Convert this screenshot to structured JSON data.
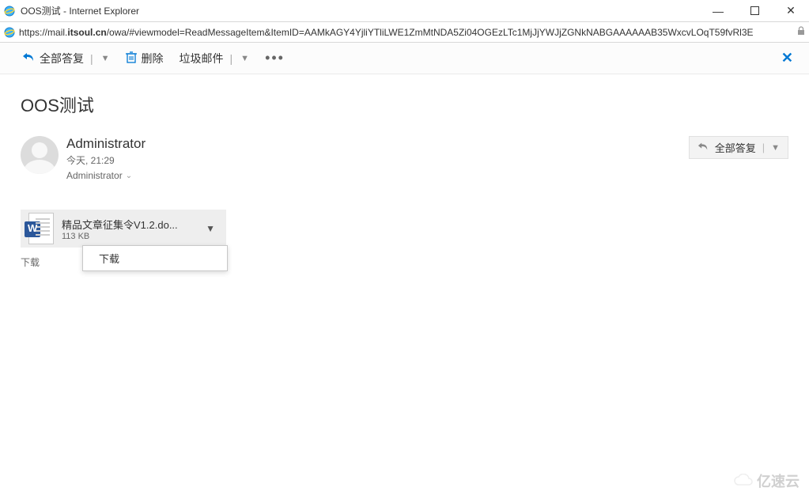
{
  "window": {
    "title": "OOS测试 - Internet Explorer",
    "url_prefix": "https://mail.",
    "url_domain": "itsoul.cn",
    "url_rest": "/owa/#viewmodel=ReadMessageItem&ItemID=AAMkAGY4YjliYTliLWE1ZmMtNDA5Zi04OGEzLTc1MjJjYWJjZGNkNABGAAAAAAB35WxcvLOqT59fvRl3E"
  },
  "toolbar": {
    "reply_all": "全部答复",
    "delete": "删除",
    "junk": "垃圾邮件"
  },
  "message": {
    "subject": "OOS测试",
    "sender": "Administrator",
    "date": "今天, 21:29",
    "recipient": "Administrator",
    "reply_all_btn": "全部答复"
  },
  "attachment": {
    "filename": "精品文章征集令V1.2.do...",
    "filesize": "113 KB",
    "download_label": "下载",
    "menu_download": "下载"
  },
  "watermark": "亿速云"
}
